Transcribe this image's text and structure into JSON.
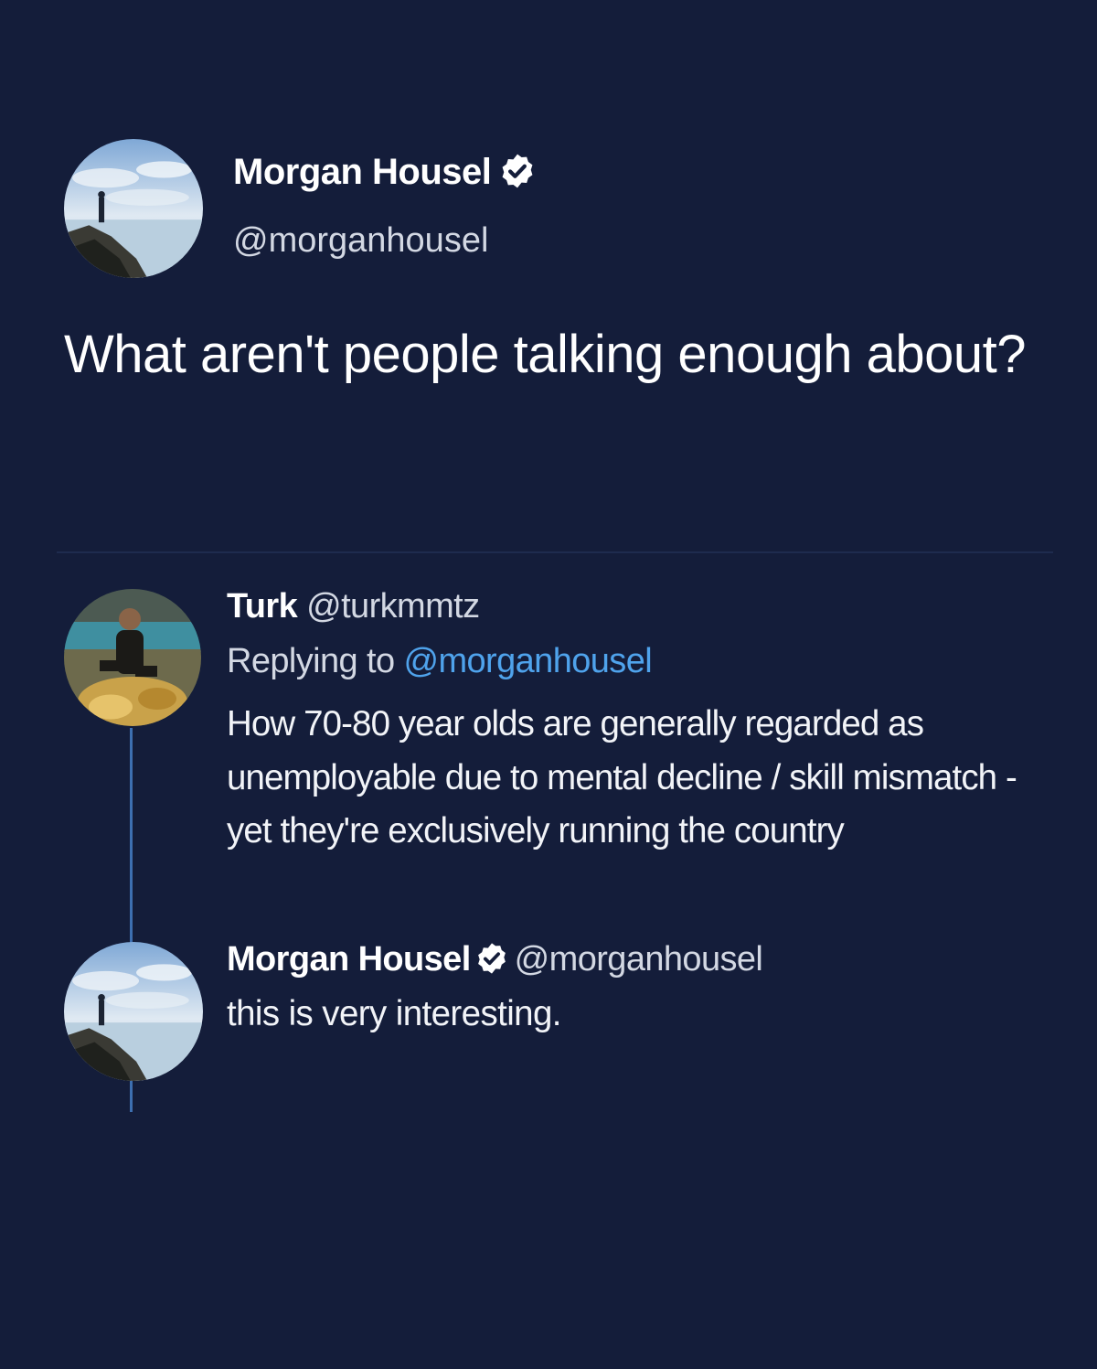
{
  "tweet": {
    "author_name": "Morgan Housel",
    "author_handle": "@morganhousel",
    "text": "What aren't people talking enough about?",
    "verified_icon": "verified-badge-icon"
  },
  "replies": [
    {
      "author_name": "Turk",
      "author_handle": "@turkmmtz",
      "replying_label": "Replying to",
      "replying_to": "@morganhousel",
      "text": "How 70-80 year olds are generally regarded as unemployable due to mental decline / skill mismatch - yet they're exclusively running the country"
    },
    {
      "author_name": "Morgan Housel",
      "author_handle": "@morganhousel",
      "text": "this is very interesting.",
      "verified_icon": "verified-badge-icon"
    }
  ],
  "colors": {
    "background": "#141d3a",
    "text": "#ffffff",
    "secondary_text": "#d3d8e3",
    "link": "#4fa3ec",
    "thread_line": "#3d6fb0"
  }
}
